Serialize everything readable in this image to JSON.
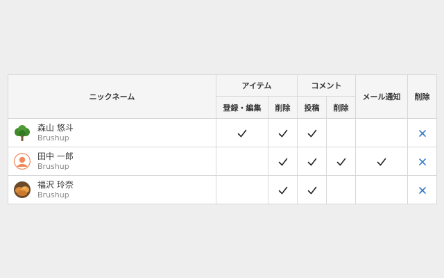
{
  "columns": {
    "nickname": "ニックネーム",
    "item_group": "アイテム",
    "item_register_edit": "登録・編集",
    "item_delete": "削除",
    "comment_group": "コメント",
    "comment_post": "投稿",
    "comment_delete": "削除",
    "mail_notify": "メール通知",
    "delete": "削除"
  },
  "users": [
    {
      "name": "森山 悠斗",
      "team": "Brushup",
      "avatar": "tree-avatar-icon",
      "perms": {
        "item_register_edit": true,
        "item_delete": true,
        "comment_post": true,
        "comment_delete": false,
        "mail_notify": false
      }
    },
    {
      "name": "田中 一郎",
      "team": "Brushup",
      "avatar": "person-avatar-icon",
      "perms": {
        "item_register_edit": false,
        "item_delete": true,
        "comment_post": true,
        "comment_delete": true,
        "mail_notify": true
      }
    },
    {
      "name": "福沢 玲奈",
      "team": "Brushup",
      "avatar": "bread-avatar-icon",
      "perms": {
        "item_register_edit": false,
        "item_delete": true,
        "comment_post": true,
        "comment_delete": false,
        "mail_notify": false
      }
    }
  ],
  "colors": {
    "delete_icon": "#3a7cc7",
    "check_icon": "#222222",
    "person_avatar": "#f08a5d",
    "tree_avatar": "#3f8a2a",
    "bread_avatar": "#d98a3a"
  }
}
